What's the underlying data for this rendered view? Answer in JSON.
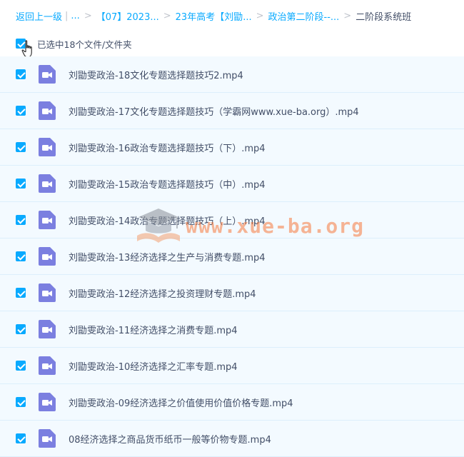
{
  "breadcrumb": {
    "back": "返回上一级",
    "ellipsis": "...",
    "items": [
      "【07】2023...",
      "23年高考【刘勖...",
      "政治第二阶段--..."
    ],
    "current": "二阶段系统班"
  },
  "selection": {
    "text": "已选中18个文件/文件夹"
  },
  "files": [
    {
      "name": "刘勖雯政治-18文化专题选择题技巧2.mp4",
      "icon": "video-file-icon"
    },
    {
      "name": "刘勖雯政治-17文化专题选择题技巧（学霸网www.xue-ba.org）.mp4",
      "icon": "video-file-icon"
    },
    {
      "name": "刘勖雯政治-16政治专题选择题技巧（下）.mp4",
      "icon": "video-file-icon"
    },
    {
      "name": "刘勖雯政治-15政治专题选择题技巧（中）.mp4",
      "icon": "video-file-icon"
    },
    {
      "name": "刘勖雯政治-14政治专题选择题技巧（上）.mp4",
      "icon": "video-file-icon"
    },
    {
      "name": "刘勖雯政治-13经济选择之生产与消费专题.mp4",
      "icon": "video-file-icon"
    },
    {
      "name": "刘勖雯政治-12经济选择之投资理财专题.mp4",
      "icon": "video-file-icon"
    },
    {
      "name": "刘勖雯政治-11经济选择之消费专题.mp4",
      "icon": "video-file-icon"
    },
    {
      "name": "刘勖雯政治-10经济选择之汇率专题.mp4",
      "icon": "video-file-icon"
    },
    {
      "name": "刘勖雯政治-09经济选择之价值使用价值价格专题.mp4",
      "icon": "video-file-icon"
    },
    {
      "name": "08经济选择之商品货币纸币一般等价物专题.mp4",
      "icon": "video-file-icon"
    }
  ],
  "watermark": {
    "text": "www.xue-ba.org",
    "icon": "graduation-cap-icon"
  },
  "colors": {
    "accent": "#09aaff",
    "row_bg": "#f3faff",
    "row_border": "#dceffc",
    "text": "#424e67",
    "video_icon": "#7b7fe0"
  }
}
